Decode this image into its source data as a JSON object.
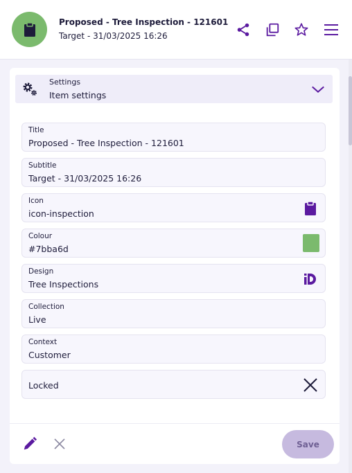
{
  "header": {
    "title": "Proposed - Tree Inspection - 121601",
    "subtitle": "Target - 31/03/2025 16:26",
    "avatar_color": "#7bba6d",
    "icons": [
      "share-icon",
      "copy-icon",
      "star-icon",
      "menu-icon"
    ]
  },
  "settings": {
    "section_label": "Settings",
    "section_title": "Item settings"
  },
  "fields": {
    "title": {
      "label": "Title",
      "value": "Proposed - Tree Inspection - 121601"
    },
    "subtitle": {
      "label": "Subtitle",
      "value": "Target - 31/03/2025 16:26"
    },
    "icon": {
      "label": "Icon",
      "value": "icon-inspection"
    },
    "colour": {
      "label": "Colour",
      "value": "#7bba6d"
    },
    "design": {
      "label": "Design",
      "value": "Tree Inspections"
    },
    "collection": {
      "label": "Collection",
      "value": "Live"
    },
    "context": {
      "label": "Context",
      "value": "Customer"
    },
    "locked": {
      "label": "Locked"
    }
  },
  "footer": {
    "save_label": "Save"
  },
  "colors": {
    "accent": "#5b1aa0",
    "swatch": "#7bba6d",
    "save_bg": "#c6badf"
  }
}
